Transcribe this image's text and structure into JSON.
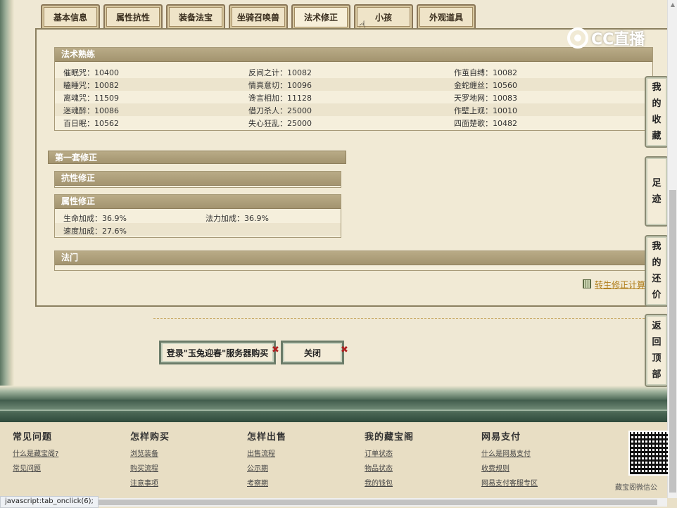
{
  "tabs": [
    {
      "label": "基本信息",
      "active": false
    },
    {
      "label": "属性抗性",
      "active": false
    },
    {
      "label": "装备法宝",
      "active": false
    },
    {
      "label": "坐骑召唤兽",
      "active": false
    },
    {
      "label": "法术修正",
      "active": true
    },
    {
      "label": "小孩",
      "active": false
    },
    {
      "label": "外观道具",
      "active": false
    }
  ],
  "spell_mastery": {
    "title": "法术熟练",
    "rows": [
      [
        "催眠咒：10400",
        "反间之计：10082",
        "作茧自缚：10082"
      ],
      [
        "瞌睡咒：10082",
        "情真意切：10096",
        "金蛇缠丝：10560"
      ],
      [
        "离魂咒：11509",
        "谗言相加：11128",
        "天罗地网：10083"
      ],
      [
        "迷魂醉：10086",
        "借刀杀人：25000",
        "作壁上观：10010"
      ],
      [
        "百日眠：10562",
        "失心狂乱：25000",
        "四面楚歌：10482"
      ]
    ]
  },
  "set1": {
    "title": "第一套修正",
    "resist": {
      "title": "抗性修正"
    },
    "attr": {
      "title": "属性修正",
      "rows": [
        [
          "生命加成：36.9%",
          "法力加成：36.9%"
        ],
        [
          "速度加成：27.6%",
          ""
        ]
      ]
    }
  },
  "school": {
    "title": "法门"
  },
  "calc_link": "转生修正计算",
  "buttons": {
    "login": "登录\"玉兔迎春\"服务器购买",
    "close": "关闭"
  },
  "side_nav": [
    {
      "label": [
        "我",
        "的",
        "收",
        "藏"
      ]
    },
    {
      "label": [
        "足",
        "迹"
      ]
    },
    {
      "label": [
        "我",
        "的",
        "还",
        "价"
      ]
    },
    {
      "label": [
        "返",
        "回",
        "顶",
        "部"
      ]
    }
  ],
  "watermark": "CC直播",
  "footer": {
    "columns": [
      {
        "title": "常见问题",
        "links": [
          "什么是藏宝阁?",
          "常见问题"
        ]
      },
      {
        "title": "怎样购买",
        "links": [
          "浏览装备",
          "购买流程",
          "注意事项"
        ]
      },
      {
        "title": "怎样出售",
        "links": [
          "出售流程",
          "公示期",
          "考察期"
        ]
      },
      {
        "title": "我的藏宝阁",
        "links": [
          "订单状态",
          "物品状态",
          "我的钱包"
        ]
      },
      {
        "title": "网易支付",
        "links": [
          "什么是网易支付",
          "收费规则",
          "网易支付客服专区"
        ]
      }
    ],
    "qr_label": "藏宝阁微信公"
  },
  "status_bar": "javascript:tab_onclick(6);"
}
